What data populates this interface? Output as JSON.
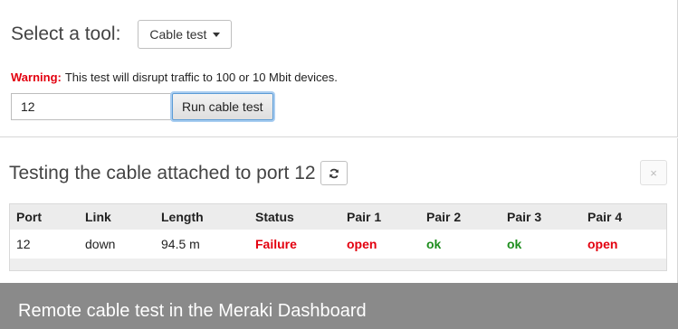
{
  "tool_selector": {
    "label": "Select a tool:",
    "selected": "Cable test"
  },
  "warning": {
    "label": "Warning:",
    "text": "This test will disrupt traffic to 100 or 10 Mbit devices."
  },
  "cable_test": {
    "port_value": "12",
    "run_label": "Run cable test"
  },
  "result": {
    "title": "Testing the cable attached to port 12",
    "close_symbol": "×"
  },
  "table": {
    "headers": [
      "Port",
      "Link",
      "Length",
      "Status",
      "Pair 1",
      "Pair 2",
      "Pair 3",
      "Pair 4"
    ],
    "rows": [
      {
        "port": "12",
        "link": "down",
        "length": "94.5 m",
        "status": "Failure",
        "pair1": "open",
        "pair2": "ok",
        "pair3": "ok",
        "pair4": "open"
      }
    ]
  },
  "caption": "Remote cable test in the Meraki Dashboard",
  "colors": {
    "failure_red": "#e3000f",
    "ok_green": "#1e8e1e",
    "caption_bg": "#8a8a8a"
  },
  "icons": {
    "refresh": "refresh-icon",
    "dropdown": "chevron-down-icon",
    "close": "close-icon"
  }
}
